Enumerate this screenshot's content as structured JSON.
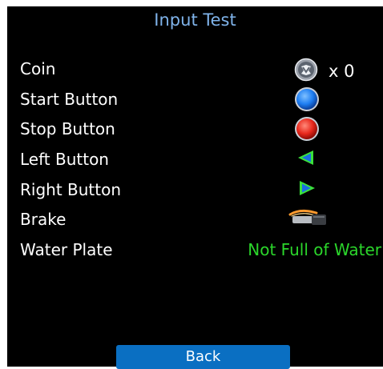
{
  "title": "Input Test",
  "rows": [
    {
      "label": "Coin",
      "icon": "coin-icon"
    },
    {
      "label": "Start Button",
      "icon": "start-button-icon"
    },
    {
      "label": "Stop Button",
      "icon": "stop-button-icon"
    },
    {
      "label": "Left Button",
      "icon": "left-arrow-icon"
    },
    {
      "label": "Right Button",
      "icon": "right-arrow-icon"
    },
    {
      "label": "Brake",
      "icon": "brake-lever-icon"
    },
    {
      "label": "Water Plate",
      "icon": ""
    }
  ],
  "coin": {
    "count_text": "x 0"
  },
  "water_plate": {
    "status": "Not Full of Water"
  },
  "back_label": "Back",
  "colors": {
    "title": "#7fb3ea",
    "status_ok": "#2bd62b",
    "back_button": "#0a6fc2",
    "start_button": "#1e7ef2",
    "stop_button": "#e8281c",
    "arrow_fill": "#1a6ee0",
    "arrow_outline": "#3be23b"
  }
}
